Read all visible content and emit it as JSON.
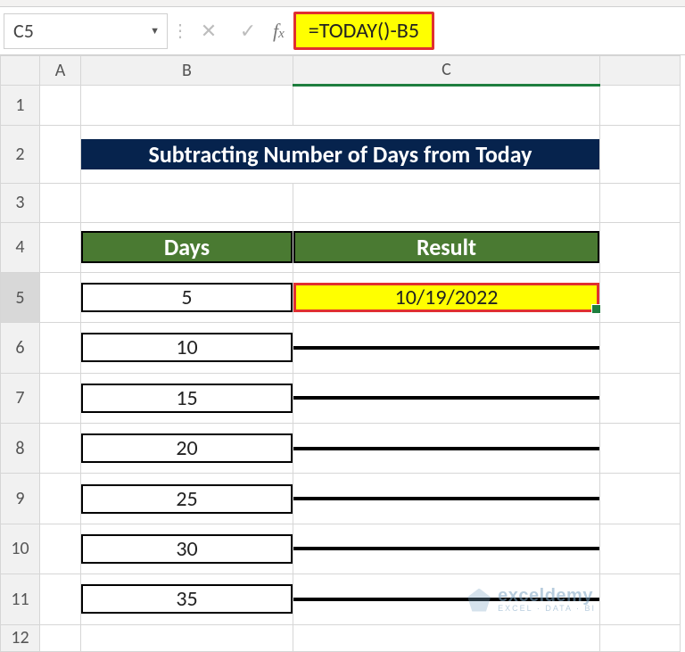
{
  "name_box": "C5",
  "formula": "=TODAY()-B5",
  "columns": [
    "A",
    "B",
    "C"
  ],
  "selected_col": "C",
  "rows": [
    "1",
    "2",
    "3",
    "4",
    "5",
    "6",
    "7",
    "8",
    "9",
    "10",
    "11",
    "12"
  ],
  "selected_row": "5",
  "banner": "Subtracting Number of Days from Today",
  "headers": {
    "b": "Days",
    "c": "Result"
  },
  "data": {
    "c5": "10/19/2022",
    "b5": "5",
    "b6": "10",
    "b7": "15",
    "b8": "20",
    "b9": "25",
    "b10": "30",
    "b11": "35"
  },
  "watermark": {
    "brand": "exceldemy",
    "tag": "EXCEL · DATA · BI"
  }
}
